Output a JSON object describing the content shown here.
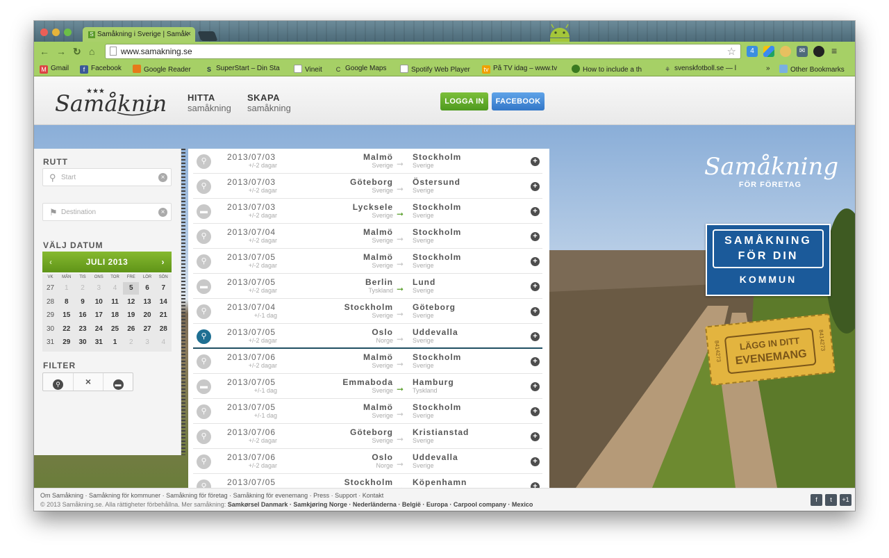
{
  "browser": {
    "tab_title": "Samåkning i Sverige | Samåk",
    "url": "www.samakning.se",
    "bookmarks": [
      "Gmail",
      "Facebook",
      "Google Reader",
      "SuperStart – Din Sta",
      "Vineit",
      "Google Maps",
      "Spotify Web Player",
      "På TV idag – www.tv",
      "How to include a th",
      "svenskfotboll.se — l",
      "»",
      "Other Bookmarks"
    ],
    "ext_badge": "4"
  },
  "header": {
    "logo": "Samåkning",
    "nav": [
      {
        "title": "HITTA",
        "sub": "samåkning"
      },
      {
        "title": "SKAPA",
        "sub": "samåkning"
      }
    ],
    "login_label": "LOGGA IN",
    "facebook_label": "FACEBOOK"
  },
  "sidebar": {
    "route_label": "RUTT",
    "start_placeholder": "Start",
    "dest_placeholder": "Destination",
    "date_label": "VÄLJ DATUM",
    "month": "JULI 2013",
    "weekday_headers": [
      "VK",
      "MÅN",
      "TIS",
      "ONS",
      "TOR",
      "FRE",
      "LÖR",
      "SÖN"
    ],
    "weeks": [
      [
        "27",
        "1",
        "2",
        "3",
        "4",
        "5",
        "6",
        "7"
      ],
      [
        "28",
        "8",
        "9",
        "10",
        "11",
        "12",
        "13",
        "14"
      ],
      [
        "29",
        "15",
        "16",
        "17",
        "18",
        "19",
        "20",
        "21"
      ],
      [
        "30",
        "22",
        "23",
        "24",
        "25",
        "26",
        "27",
        "28"
      ],
      [
        "31",
        "29",
        "30",
        "31",
        "1",
        "2",
        "3",
        "4"
      ]
    ],
    "filter_label": "FILTER",
    "filters": [
      "walker-icon",
      "close-icon",
      "car-icon"
    ]
  },
  "rides": [
    {
      "date": "2013/07/03",
      "flex": "+/-2 dagar",
      "from": "Malmö",
      "from_country": "Sverige",
      "to": "Stockholm",
      "to_country": "Sverige",
      "type": "passenger"
    },
    {
      "date": "2013/07/03",
      "flex": "+/-2 dagar",
      "from": "Göteborg",
      "from_country": "Sverige",
      "to": "Östersund",
      "to_country": "Sverige",
      "type": "passenger"
    },
    {
      "date": "2013/07/03",
      "flex": "+/-2 dagar",
      "from": "Lycksele",
      "from_country": "Sverige",
      "to": "Stockholm",
      "to_country": "Sverige",
      "type": "driver"
    },
    {
      "date": "2013/07/04",
      "flex": "+/-2 dagar",
      "from": "Malmö",
      "from_country": "Sverige",
      "to": "Stockholm",
      "to_country": "Sverige",
      "type": "passenger"
    },
    {
      "date": "2013/07/05",
      "flex": "+/-2 dagar",
      "from": "Malmö",
      "from_country": "Sverige",
      "to": "Stockholm",
      "to_country": "Sverige",
      "type": "passenger"
    },
    {
      "date": "2013/07/05",
      "flex": "+/-2 dagar",
      "from": "Berlin",
      "from_country": "Tyskland",
      "to": "Lund",
      "to_country": "Sverige",
      "type": "driver"
    },
    {
      "date": "2013/07/04",
      "flex": "+/-1 dag",
      "from": "Stockholm",
      "from_country": "Sverige",
      "to": "Göteborg",
      "to_country": "Sverige",
      "type": "passenger"
    },
    {
      "date": "2013/07/05",
      "flex": "+/-2 dagar",
      "from": "Oslo",
      "from_country": "Norge",
      "to": "Uddevalla",
      "to_country": "Sverige",
      "type": "passenger",
      "selected": true
    },
    {
      "date": "2013/07/06",
      "flex": "+/-2 dagar",
      "from": "Malmö",
      "from_country": "Sverige",
      "to": "Stockholm",
      "to_country": "Sverige",
      "type": "passenger"
    },
    {
      "date": "2013/07/05",
      "flex": "+/-1 dag",
      "from": "Emmaboda",
      "from_country": "Sverige",
      "to": "Hamburg",
      "to_country": "Tyskland",
      "type": "driver"
    },
    {
      "date": "2013/07/05",
      "flex": "+/-1 dag",
      "from": "Malmö",
      "from_country": "Sverige",
      "to": "Stockholm",
      "to_country": "Sverige",
      "type": "passenger"
    },
    {
      "date": "2013/07/06",
      "flex": "+/-2 dagar",
      "from": "Göteborg",
      "from_country": "Sverige",
      "to": "Kristianstad",
      "to_country": "Sverige",
      "type": "passenger"
    },
    {
      "date": "2013/07/06",
      "flex": "+/-2 dagar",
      "from": "Oslo",
      "from_country": "Norge",
      "to": "Uddevalla",
      "to_country": "Sverige",
      "type": "passenger"
    },
    {
      "date": "2013/07/05",
      "flex": "",
      "from": "Stockholm",
      "from_country": "",
      "to": "Köpenhamn",
      "to_country": "",
      "type": "passenger"
    }
  ],
  "ads": {
    "foretag_title": "Samåkning",
    "foretag_sub": "FÖR FÖRETAG",
    "kommun_lines": [
      "SAMÅKNING",
      "FÖR DIN",
      "KOMMUN"
    ],
    "event_lines": [
      "LÄGG IN DITT",
      "EVENEMANG"
    ],
    "ticket_no": "8414273"
  },
  "footer": {
    "links": "Om Samåkning · Samåkning för kommuner · Samåkning för företag · Samåkning för evenemang · Press · Support · Kontakt",
    "copyright": "© 2013 Samåkning.se. Alla rättigheter förbehållna. Mer samåkning:",
    "more": "Samkørsel Danmark · Samkjøring Norge · Nederländerna · België · Europa · Carpool company · Mexico",
    "social": [
      "f",
      "t",
      "+1"
    ]
  }
}
